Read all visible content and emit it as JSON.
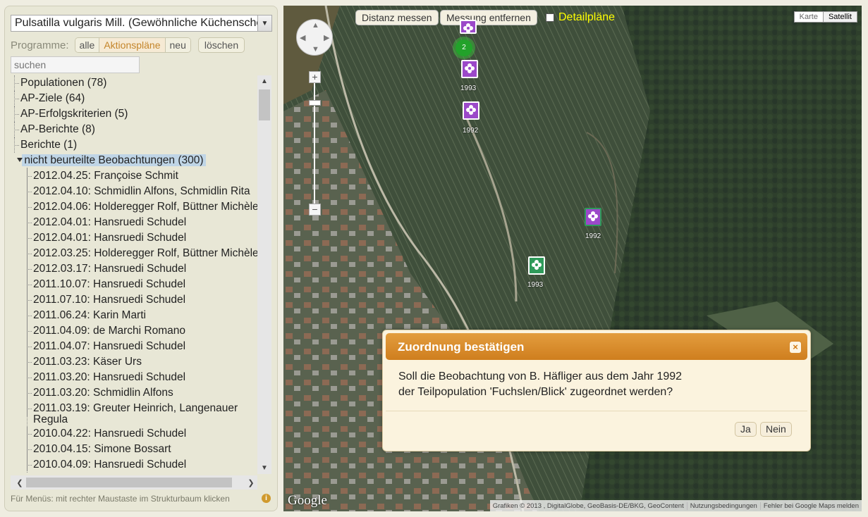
{
  "left_panel": {
    "species_select": "Pulsatilla vulgaris Mill. (Gewöhnliche Küchenschelle)",
    "programs_label": "Programme:",
    "programs": [
      {
        "label": "alle",
        "active": false
      },
      {
        "label": "Aktionspläne",
        "active": true
      },
      {
        "label": "neu",
        "active": false
      }
    ],
    "delete_label": "löschen",
    "search_placeholder": "suchen",
    "tree": {
      "top_nodes": [
        "Populationen (78)",
        "AP-Ziele (64)",
        "AP-Erfolgskriterien (5)",
        "AP-Berichte (8)",
        "Berichte (1)"
      ],
      "selected_node": "nicht beurteilte Beobachtungen (300)",
      "children": [
        "2012.04.25: Françoise Schmit",
        "2012.04.10: Schmidlin Alfons, Schmidlin Rita",
        "2012.04.06: Holderegger Rolf, Büttner Michèle",
        "2012.04.01: Hansruedi Schudel",
        "2012.04.01: Hansruedi Schudel",
        "2012.03.25: Holderegger Rolf, Büttner Michèle",
        "2012.03.17: Hansruedi Schudel",
        "2011.10.07: Hansruedi Schudel",
        "2011.07.10: Hansruedi Schudel",
        "2011.06.24: Karin Marti",
        "2011.04.09: de Marchi Romano",
        "2011.04.07: Hansruedi Schudel",
        "2011.03.23: Käser Urs",
        "2011.03.20: Hansruedi Schudel",
        "2011.03.20: Schmidlin Alfons",
        "2011.03.19: Greuter Heinrich, Langenauer Regula",
        "2010.04.22: Hansruedi Schudel",
        "2010.04.15: Simone Bossart",
        "2010.04.09: Hansruedi Schudel"
      ]
    },
    "footer_hint": "Für Menüs: mit rechter Maustaste im Strukturbaum klicken"
  },
  "map": {
    "measure_btn": "Distanz messen",
    "remove_measure_btn": "Messung entfernen",
    "detail_label": "Detailpläne",
    "map_types": [
      {
        "label": "Karte",
        "active": false
      },
      {
        "label": "Satellit",
        "active": true
      }
    ],
    "cluster_count": "2",
    "marker_labels": [
      "1993",
      "1992",
      "1992",
      "1993"
    ],
    "google_logo": "Google",
    "attribution": [
      "Grafiken © 2013 , DigitalGlobe, GeoBasis-DE/BKG, GeoContent",
      "Nutzungsbedingungen",
      "Fehler bei Google Maps melden"
    ],
    "colors": {
      "purple_marker": "#9b48c9",
      "green_marker": "#2f9a5a",
      "detail_label": "#ffff00"
    }
  },
  "dialog": {
    "title": "Zuordnung bestätigen",
    "line1": "Soll die Beobachtung von B. Häfliger aus dem Jahr 1992",
    "line2": "der Teilpopulation 'Fuchslen/Blick' zugeordnet werden?",
    "yes_label": "Ja",
    "no_label": "Nein",
    "header_color": "#d98a2c"
  }
}
